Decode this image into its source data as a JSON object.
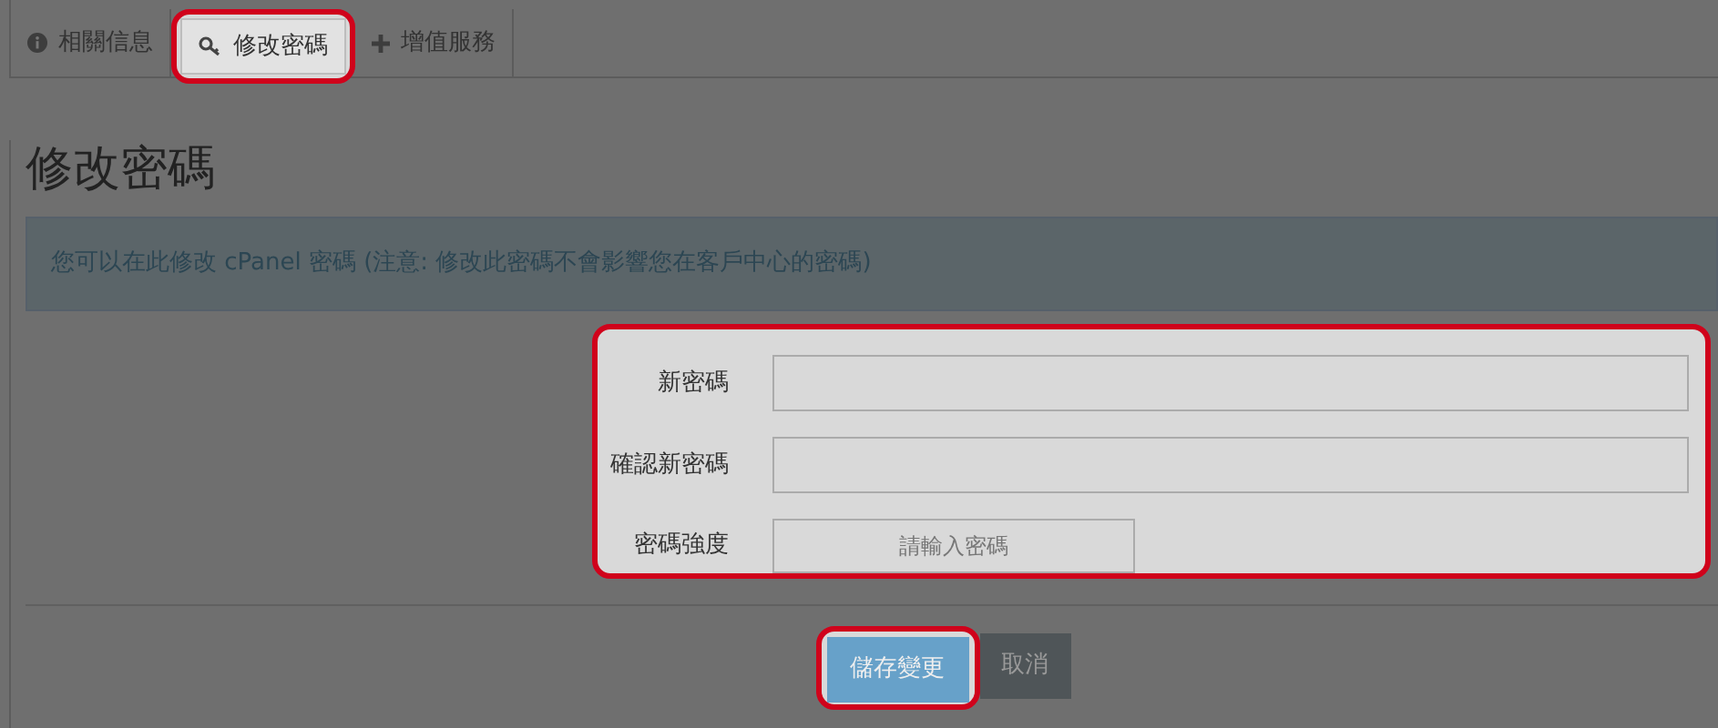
{
  "tabs": [
    {
      "label": "相關信息",
      "selected": false,
      "highlighted": false
    },
    {
      "label": "修改密碼",
      "selected": true,
      "highlighted": true
    },
    {
      "label": "增值服務",
      "selected": false,
      "highlighted": false
    }
  ],
  "heading": "修改密碼",
  "alert": "您可以在此修改 cPanel 密碼 (注意: 修改此密碼不會影響您在客戶中心的密碼)",
  "form": {
    "highlighted": true,
    "fields": [
      {
        "kind": "input",
        "label": "新密碼"
      },
      {
        "kind": "input",
        "label": "確認新密碼"
      },
      {
        "kind": "meter",
        "label": "密碼強度",
        "text": "請輸入密碼"
      }
    ]
  },
  "buttons": [
    {
      "kind": "primary",
      "label": "儲存變更",
      "highlighted": true
    },
    {
      "kind": "default",
      "label": "取消",
      "highlighted": false
    }
  ]
}
